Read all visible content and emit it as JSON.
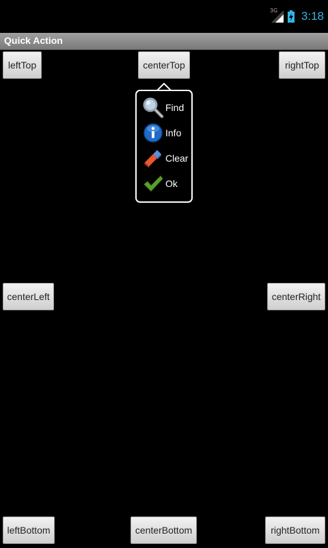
{
  "status": {
    "network": "3G",
    "time": "3:18"
  },
  "app": {
    "title": "Quick Action"
  },
  "buttons": {
    "left_top": "leftTop",
    "center_top": "centerTop",
    "right_top": "rightTop",
    "center_left": "centerLeft",
    "center_right": "centerRight",
    "left_bottom": "leftBottom",
    "center_bottom": "centerBottom",
    "right_bottom": "rightBottom"
  },
  "quick_action_menu": {
    "items": [
      {
        "label": "Find",
        "icon": "magnifier-icon"
      },
      {
        "label": "Info",
        "icon": "info-icon"
      },
      {
        "label": "Clear",
        "icon": "eraser-icon"
      },
      {
        "label": "Ok",
        "icon": "checkmark-icon"
      }
    ]
  },
  "colors": {
    "background": "#000000",
    "time": "#33b5e5",
    "titlebar": "#8e8e8e",
    "button": "#e0e0e0"
  }
}
